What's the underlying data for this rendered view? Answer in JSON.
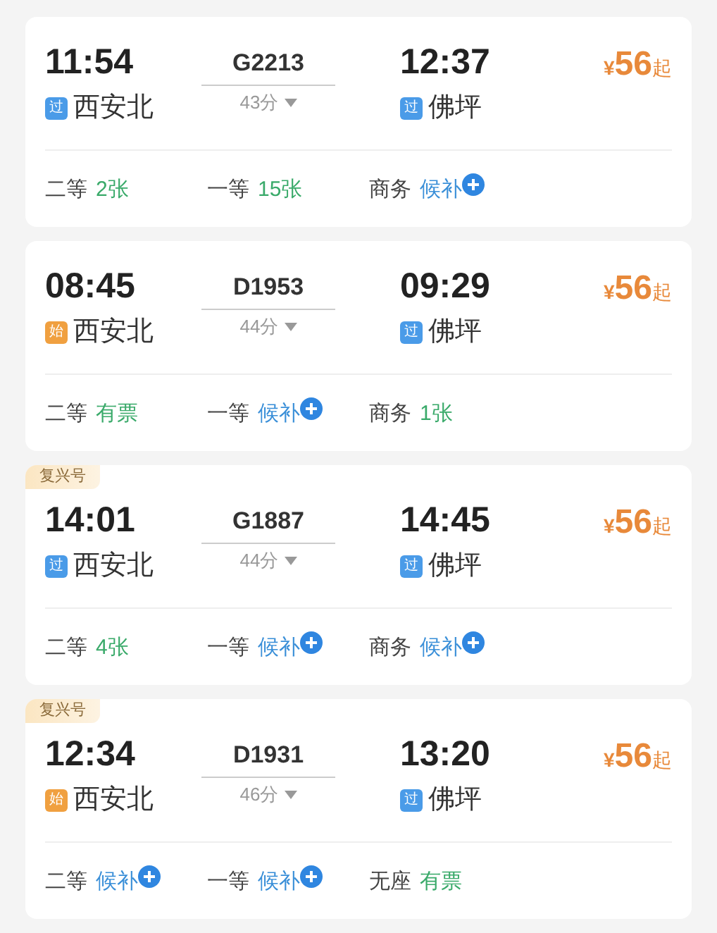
{
  "trains": [
    {
      "depart_time": "11:54",
      "train_no": "G2213",
      "duration": "43分",
      "arrive_time": "12:37",
      "price_symbol": "¥",
      "price": "56",
      "price_suffix": "起",
      "from": {
        "tag": "过",
        "kind": "pass",
        "name": "西安北"
      },
      "to": {
        "tag": "过",
        "kind": "pass",
        "name": "佛坪"
      },
      "seats": [
        {
          "class": "二等",
          "status": "2张",
          "kind": "count"
        },
        {
          "class": "一等",
          "status": "15张",
          "kind": "count"
        },
        {
          "class": "商务",
          "status": "候补",
          "kind": "waitlist"
        }
      ]
    },
    {
      "depart_time": "08:45",
      "train_no": "D1953",
      "duration": "44分",
      "arrive_time": "09:29",
      "price_symbol": "¥",
      "price": "56",
      "price_suffix": "起",
      "from": {
        "tag": "始",
        "kind": "origin",
        "name": "西安北"
      },
      "to": {
        "tag": "过",
        "kind": "pass",
        "name": "佛坪"
      },
      "seats": [
        {
          "class": "二等",
          "status": "有票",
          "kind": "count"
        },
        {
          "class": "一等",
          "status": "候补",
          "kind": "waitlist"
        },
        {
          "class": "商务",
          "status": "1张",
          "kind": "count"
        }
      ]
    },
    {
      "badge": "复兴号",
      "depart_time": "14:01",
      "train_no": "G1887",
      "duration": "44分",
      "arrive_time": "14:45",
      "price_symbol": "¥",
      "price": "56",
      "price_suffix": "起",
      "from": {
        "tag": "过",
        "kind": "pass",
        "name": "西安北"
      },
      "to": {
        "tag": "过",
        "kind": "pass",
        "name": "佛坪"
      },
      "seats": [
        {
          "class": "二等",
          "status": "4张",
          "kind": "count"
        },
        {
          "class": "一等",
          "status": "候补",
          "kind": "waitlist"
        },
        {
          "class": "商务",
          "status": "候补",
          "kind": "waitlist"
        }
      ]
    },
    {
      "badge": "复兴号",
      "depart_time": "12:34",
      "train_no": "D1931",
      "duration": "46分",
      "arrive_time": "13:20",
      "price_symbol": "¥",
      "price": "56",
      "price_suffix": "起",
      "from": {
        "tag": "始",
        "kind": "origin",
        "name": "西安北"
      },
      "to": {
        "tag": "过",
        "kind": "pass",
        "name": "佛坪"
      },
      "seats": [
        {
          "class": "二等",
          "status": "候补",
          "kind": "waitlist"
        },
        {
          "class": "一等",
          "status": "候补",
          "kind": "waitlist"
        },
        {
          "class": "无座",
          "status": "有票",
          "kind": "count"
        }
      ]
    }
  ]
}
